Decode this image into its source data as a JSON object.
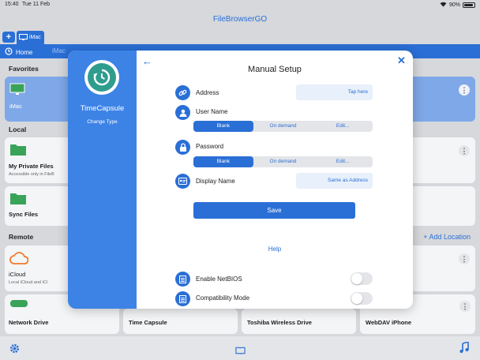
{
  "status_bar": {
    "time": "15:40",
    "date": "Tue 11 Feb",
    "battery": "90%"
  },
  "app": {
    "title": "FileBrowserGO"
  },
  "tabs": [
    {
      "label": "iMac"
    }
  ],
  "pathbar": {
    "home": "Home",
    "current": "iMac"
  },
  "sections": {
    "favorites": "Favorites",
    "local": "Local",
    "remote": "Remote",
    "add_location": "+ Add Location"
  },
  "favorites": [
    {
      "label": "iMac"
    }
  ],
  "local": [
    {
      "label": "My Private Files",
      "sub": "Accessible only in FileB"
    },
    {
      "label": "Sync Files"
    }
  ],
  "remote": [
    {
      "label": "iCloud",
      "sub": "Local iCloud and iCl"
    },
    {
      "label": "Network Drive"
    },
    {
      "label": "Time Capsule"
    },
    {
      "label": "Toshiba Wireless Drive"
    },
    {
      "label": "WebDAV iPhone"
    }
  ],
  "modal": {
    "side": {
      "name": "TimeCapsule",
      "change": "Change Type"
    },
    "title": "Manual Setup",
    "address": {
      "label": "Address",
      "value": "Tap here"
    },
    "username": {
      "label": "User Name",
      "options": [
        "Blank",
        "On demand",
        "Edit..."
      ]
    },
    "password": {
      "label": "Password",
      "options": [
        "Blank",
        "On demand",
        "Edit..."
      ]
    },
    "display_name": {
      "label": "Display Name",
      "value": "Same as Address"
    },
    "save": "Save",
    "help": "Help",
    "netbios": {
      "label": "Enable NetBIOS"
    },
    "compat": {
      "label": "Compatibility Mode"
    }
  },
  "colors": {
    "accent": "#2a6fd6",
    "side": "#3d83e6",
    "timecapsule": "#2f9d8e"
  }
}
